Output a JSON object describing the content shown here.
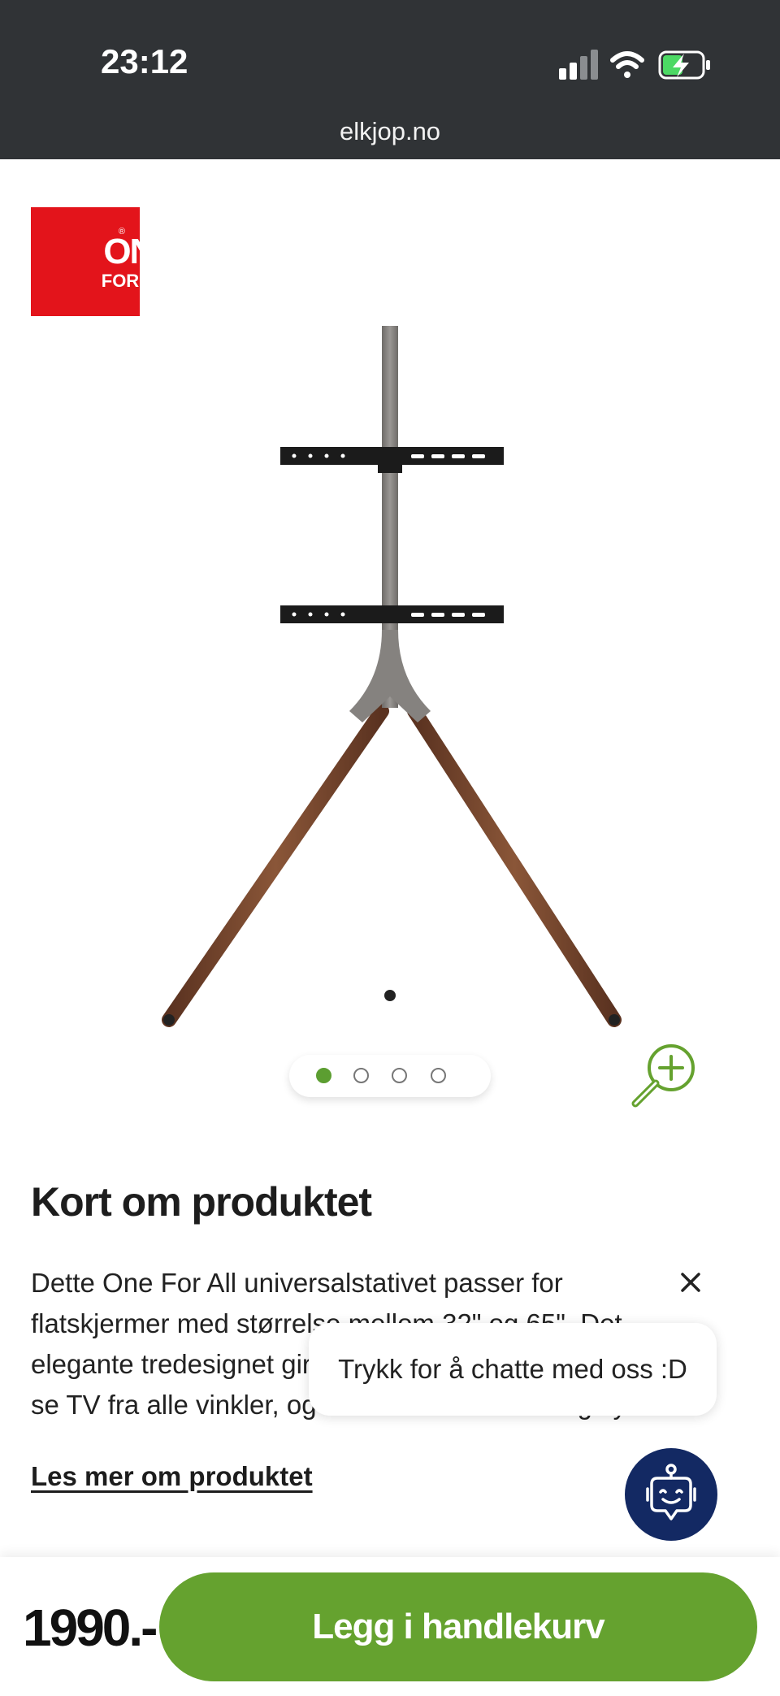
{
  "status_bar": {
    "time": "23:12",
    "url": "elkjop.no"
  },
  "brand_logo": {
    "line1": "ONE",
    "line2": "FOR ALL",
    "mark": "®",
    "color": "#e3141b"
  },
  "gallery": {
    "image_count": 4,
    "active_index": 0
  },
  "section": {
    "heading": "Kort om produktet",
    "description_lines": [
      "Dette One For All universalstativet passer for",
      "flatskjermer med størrelse mellom 32\" og 65\". Det",
      "elegante tredesignet gir deg muligheten til å kunne",
      "se TV fra alle vinkler, og er enkelt å montere og flytte."
    ],
    "read_more": "Les mer om produktet"
  },
  "chat": {
    "bubble_text": "Trykk for å chatte med oss :D"
  },
  "purchase": {
    "price": "1990.-",
    "add_to_cart": "Legg i handlekurv"
  },
  "colors": {
    "accent_green": "#65a22f",
    "status_bar": "#303336",
    "chat_navy": "#132963"
  }
}
